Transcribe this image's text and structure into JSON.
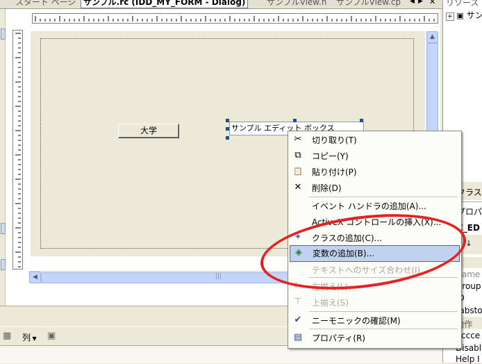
{
  "tabs": {
    "start_page": "スタート ページ",
    "rc_dialog": "サンプル.rc (IDD_MY_FORM - Dialog)",
    "view_h": "サンプルView.h",
    "view_cpp": "サンプルView.cp"
  },
  "dialog": {
    "button_label": "大学",
    "edit_text": "サンプル エディット ボックス"
  },
  "context_menu": {
    "items": [
      {
        "label": "切り取り(T)",
        "icon": "scissors-icon",
        "glyph": "✂",
        "enabled": true
      },
      {
        "label": "コピー(Y)",
        "icon": "copy-icon",
        "glyph": "⧉",
        "enabled": true
      },
      {
        "label": "貼り付け(P)",
        "icon": "paste-icon",
        "glyph": "📋",
        "enabled": true
      },
      {
        "label": "削除(D)",
        "icon": "delete-x-icon",
        "glyph": "✕",
        "enabled": true
      },
      {
        "label": "イベント ハンドラの追加(A)...",
        "icon": "",
        "glyph": "",
        "enabled": true
      },
      {
        "label": "ActiveX コントロールの挿入(X)...",
        "icon": "",
        "glyph": "",
        "enabled": true
      },
      {
        "label": "クラスの追加(C)...",
        "icon": "add-class-icon",
        "glyph": "✦",
        "enabled": true
      },
      {
        "label": "変数の追加(B)...",
        "icon": "add-variable-icon",
        "glyph": "◈",
        "enabled": true,
        "highlighted": true
      },
      {
        "label": "テキストへのサイズ合わせ(I)",
        "icon": "",
        "glyph": "",
        "enabled": false
      },
      {
        "label": "左揃え(L)",
        "icon": "align-left-icon",
        "glyph": "⊫",
        "enabled": false
      },
      {
        "label": "上揃え(S)",
        "icon": "align-top-icon",
        "glyph": "⊤",
        "enabled": false
      },
      {
        "label": "ニーモニックの確認(M)",
        "icon": "check-mnemonic-icon",
        "glyph": "✔",
        "enabled": true
      },
      {
        "label": "プロパティ(R)",
        "icon": "properties-icon",
        "glyph": "▤",
        "enabled": true
      }
    ]
  },
  "bottom_toolbar": {
    "column_label": "列"
  },
  "right_panel": {
    "title": "リソース ビ",
    "tree_root": "サン",
    "class_header": "クラス",
    "property_header": "プロパティ",
    "object_id": "C_ED",
    "rows": [
      "Name",
      "Group",
      "ID",
      "Tabsto",
      "動作",
      "Accce",
      "Disable",
      "Help I"
    ]
  },
  "colors": {
    "highlight_bg": "#c1d2ee",
    "highlight_border": "#316ac5",
    "annotation": "#e82020",
    "selection_handle": "#1f4b9a"
  }
}
